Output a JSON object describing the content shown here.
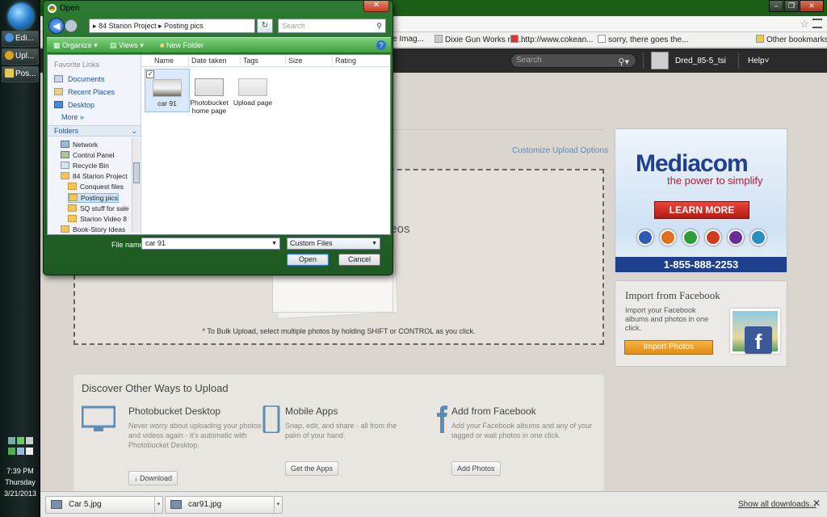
{
  "taskbar": {
    "items": [
      {
        "label": "Edi...",
        "icon": "chrome-icon",
        "color": "#4a8fd8"
      },
      {
        "label": "Upl...",
        "icon": "chrome-icon",
        "color": "#d9a128"
      },
      {
        "label": "Pos...",
        "icon": "folder-icon",
        "color": "#e8c850"
      }
    ],
    "clock": {
      "time": "7:39 PM",
      "day": "Thursday",
      "date": "3/21/2013"
    }
  },
  "browser": {
    "bookmarks": [
      "e Imag...",
      "Dixie Gun Works mu...",
      "http://www.cokean...",
      "sorry, there goes the...",
      "Other bookmarks"
    ]
  },
  "site": {
    "search_placeholder": "Search",
    "username": "Dred_85-5_tsi",
    "help_label": "Help"
  },
  "upload": {
    "customize_link": "Customize Upload Options",
    "dropzone_title": "nd Videos",
    "bulk_note": "* To Bulk Upload, select multiple photos by holding SHIFT or CONTROL as you click."
  },
  "discover": {
    "title": "Discover Other Ways to Upload",
    "columns": [
      {
        "heading": "Photobucket Desktop",
        "text": "Never worry about uploading your photos and videos again - it's automatic with Photobucket Desktop.",
        "button": "Download",
        "button_icon": "down-arrow-icon"
      },
      {
        "heading": "Mobile Apps",
        "text": "Snap, edit, and share - all from the palm of your hand.",
        "button": "Get the Apps"
      },
      {
        "heading": "Add from Facebook",
        "text": "Add your Facebook albums and any of your tagged or wall photos in one click.",
        "button": "Add Photos"
      }
    ]
  },
  "ad": {
    "brand": "Mediacom",
    "tagline": "the power to simplify",
    "cta": "LEARN MORE",
    "phone": "1-855-888-2253",
    "colors": [
      "#2b5cb8",
      "#e0701a",
      "#2c9c3a",
      "#d03a1e",
      "#6a2c9c",
      "#2a8fc0"
    ]
  },
  "facebook_import": {
    "title": "Import from Facebook",
    "text": "Import your Facebook albums and photos in one click.",
    "button": "Import Photos",
    "logo_letter": "f"
  },
  "downloads": {
    "items": [
      "Car 5.jpg",
      "car91.jpg"
    ],
    "show_all": "Show all downloads..."
  },
  "dialog": {
    "title": "Open",
    "path": [
      "84 Starion Project",
      "Posting pics"
    ],
    "search_placeholder": "Search",
    "toolbar": {
      "organize": "Organize",
      "views": "Views",
      "new_folder": "New Folder"
    },
    "favorites_header": "Favorite Links",
    "favorites": [
      "Documents",
      "Recent Places",
      "Desktop"
    ],
    "more_label": "More",
    "folders_header": "Folders",
    "tree": [
      "Network",
      "Control Panel",
      "Recycle Bin",
      "84 Starion Project",
      "Conquest files",
      "Posting pics",
      "SQ stuff for sale",
      "Starion Video 8",
      "Book-Story Ideas"
    ],
    "columns": [
      "Name",
      "Date taken",
      "Tags",
      "Size",
      "Rating"
    ],
    "files": [
      {
        "name": "car 91"
      },
      {
        "name": "Photobucket home page"
      },
      {
        "name": "Upload page"
      }
    ],
    "file_name_label": "File name:",
    "file_name_value": "car 91",
    "file_type": "Custom Files",
    "open_label": "Open",
    "cancel_label": "Cancel"
  }
}
